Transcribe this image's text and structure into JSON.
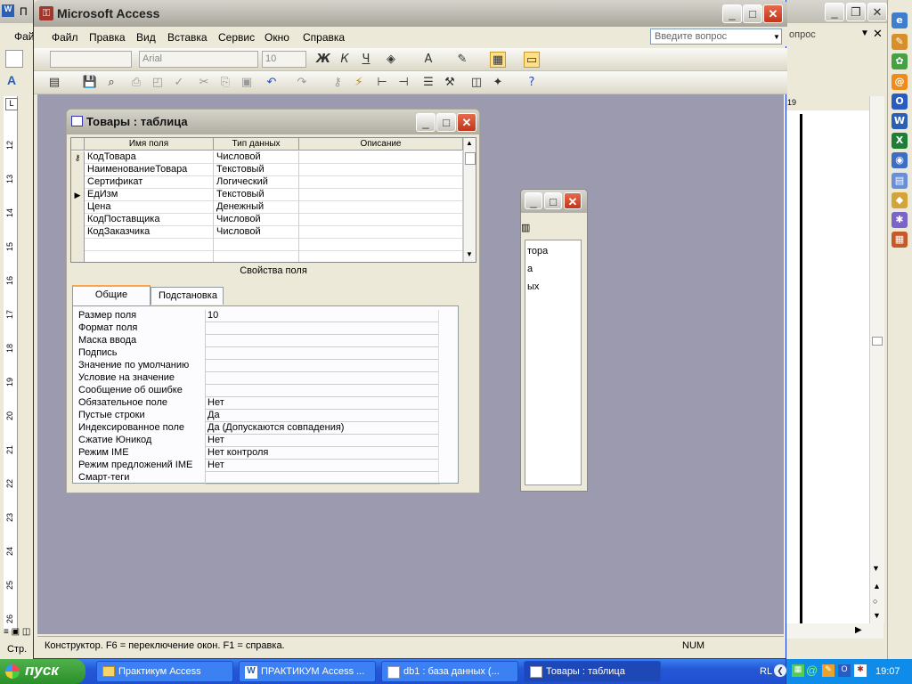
{
  "word": {
    "title_fragment": "П",
    "menu_fragment": "Фай",
    "help_fragment": "опрос",
    "ruler_numbers": [
      "12",
      "13",
      "14",
      "15",
      "16",
      "17",
      "18",
      "19",
      "20",
      "21",
      "22",
      "23",
      "24",
      "25",
      "26"
    ],
    "page_number": "19",
    "status_fragment": "Стр."
  },
  "access": {
    "title": "Microsoft Access",
    "menu": [
      "Файл",
      "Правка",
      "Вид",
      "Вставка",
      "Сервис",
      "Окно",
      "Справка"
    ],
    "help_placeholder": "Введите вопрос",
    "font_name": "Arial",
    "font_size": "10",
    "format_bold": "Ж",
    "format_italic": "К",
    "format_underline": "Ч",
    "status_text": "Конструктор.  F6 = переключение окон.  F1 = справка.",
    "status_num": "NUM"
  },
  "bg_window": {
    "lines": [
      "тора",
      "а",
      "ых"
    ]
  },
  "table_window": {
    "title": "Товары : таблица",
    "columns": [
      "Имя поля",
      "Тип данных",
      "Описание"
    ],
    "rows": [
      {
        "name": "КодТовара",
        "type": "Числовой",
        "marker": "key"
      },
      {
        "name": "НаименованиеТовара",
        "type": "Текстовый",
        "marker": ""
      },
      {
        "name": "Сертификат",
        "type": "Логический",
        "marker": ""
      },
      {
        "name": "ЕдИзм",
        "type": "Текстовый",
        "marker": "current"
      },
      {
        "name": "Цена",
        "type": "Денежный",
        "marker": ""
      },
      {
        "name": "КодПоставщика",
        "type": "Числовой",
        "marker": ""
      },
      {
        "name": "КодЗаказчика",
        "type": "Числовой",
        "marker": ""
      }
    ],
    "props_label": "Свойства поля",
    "tabs": [
      "Общие",
      "Подстановка"
    ],
    "properties": [
      {
        "label": "Размер поля",
        "value": "10"
      },
      {
        "label": "Формат поля",
        "value": ""
      },
      {
        "label": "Маска ввода",
        "value": ""
      },
      {
        "label": "Подпись",
        "value": ""
      },
      {
        "label": "Значение по умолчанию",
        "value": ""
      },
      {
        "label": "Условие на значение",
        "value": ""
      },
      {
        "label": "Сообщение об ошибке",
        "value": ""
      },
      {
        "label": "Обязательное поле",
        "value": "Нет"
      },
      {
        "label": "Пустые строки",
        "value": "Да"
      },
      {
        "label": "Индексированное поле",
        "value": "Да (Допускаются совпадения)"
      },
      {
        "label": "Сжатие Юникод",
        "value": "Нет"
      },
      {
        "label": "Режим IME",
        "value": "Нет контроля"
      },
      {
        "label": "Режим предложений IME",
        "value": "Нет"
      },
      {
        "label": "Смарт-теги",
        "value": ""
      }
    ]
  },
  "taskbar": {
    "start": "пуск",
    "tasks": [
      "Практикум Access",
      "ПРАКТИКУМ Access ...",
      "db1 : база данных (...",
      "Товары : таблица"
    ],
    "lang": "RL",
    "clock": "19:07"
  }
}
